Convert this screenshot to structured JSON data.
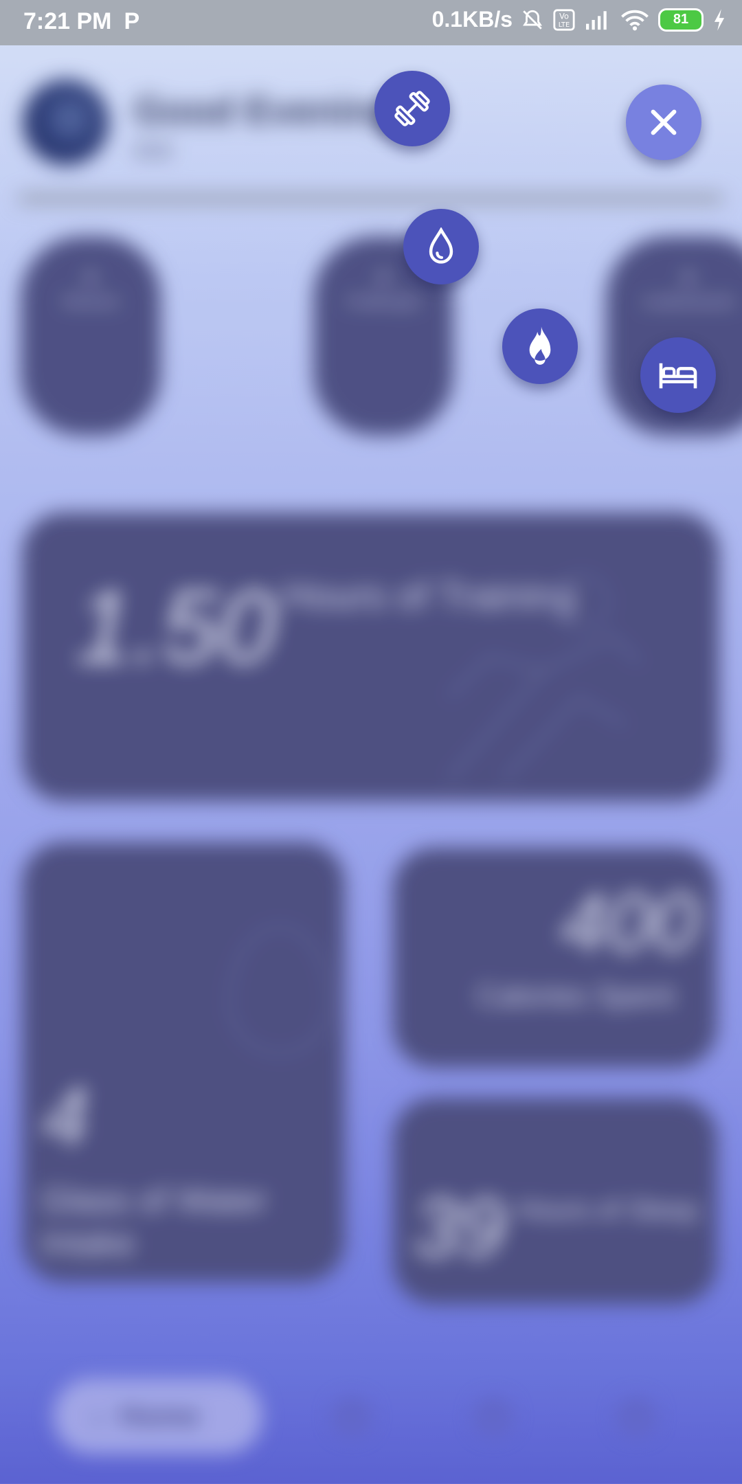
{
  "status_bar": {
    "time": "7:21 PM",
    "app_indicator": "P",
    "net_speed": "0.1KB/s",
    "battery": "81",
    "icons": [
      "mute-bell-icon",
      "volte-icon",
      "signal-icon",
      "wifi-icon",
      "battery-icon",
      "charging-icon"
    ]
  },
  "header": {
    "greeting": "Good Evening",
    "username": "ccc"
  },
  "shortcuts": {
    "items": [
      {
        "label": "Workout"
      },
      {
        "label": "Challenges"
      },
      {
        "label": "Leaderboards"
      }
    ]
  },
  "training_card": {
    "value": "1.50",
    "unit": "Hours of Training"
  },
  "water_card": {
    "value": "4",
    "label": "Glass of Water Intake"
  },
  "calories_card": {
    "value": "400",
    "label": "Calories Spent"
  },
  "sleep_card": {
    "value": "39",
    "label": "Hours of Sleep"
  },
  "bottom_nav": {
    "home_label": "Home"
  },
  "fab_menu": {
    "items": [
      "dumbbell-icon",
      "water-drop-icon",
      "flame-icon",
      "bed-icon"
    ],
    "close_icon": "close-icon"
  },
  "colors": {
    "fab": "#4c53ba",
    "fab_close": "#7881e0",
    "card": "#4b4c7b",
    "status_bar": "#a6acb5"
  }
}
